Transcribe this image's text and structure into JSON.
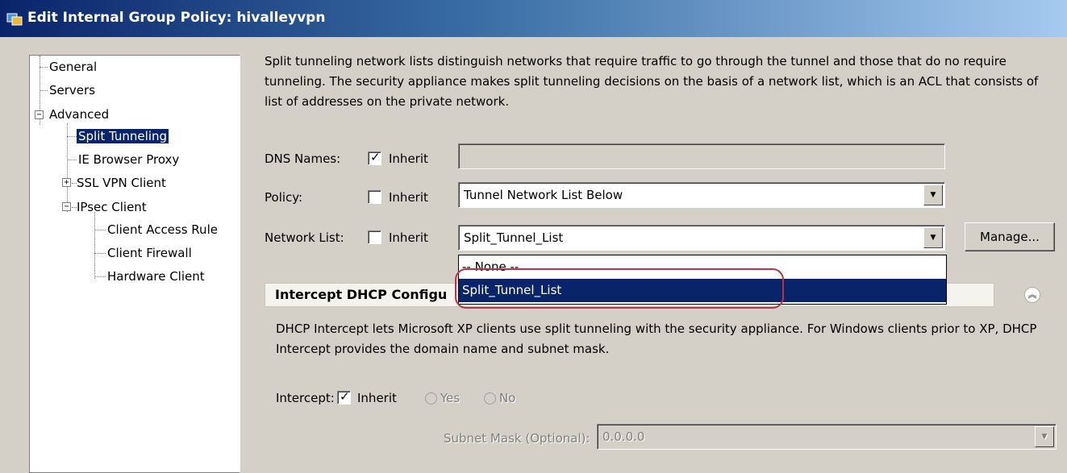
{
  "window": {
    "title": "Edit Internal Group Policy: hivalleyvpn"
  },
  "tree": {
    "items": [
      {
        "label": "General"
      },
      {
        "label": "Servers"
      },
      {
        "label": "Advanced"
      },
      {
        "label": "Split Tunneling"
      },
      {
        "label": "IE Browser Proxy"
      },
      {
        "label": "SSL VPN Client"
      },
      {
        "label": "IPsec Client"
      },
      {
        "label": "Client Access Rule"
      },
      {
        "label": "Client Firewall"
      },
      {
        "label": "Hardware Client"
      }
    ],
    "selected": "Split Tunneling"
  },
  "description": "Split tunneling network lists distinguish networks that require traffic to go through the tunnel and those that do no require tunneling. The security appliance makes split tunneling decisions on the basis of a network list, which is an ACL that consists of list of addresses on the private network.",
  "fields": {
    "dns_names": {
      "label": "DNS Names:",
      "inherit_label": "Inherit",
      "inherit_checked": true,
      "value": ""
    },
    "policy": {
      "label": "Policy:",
      "inherit_label": "Inherit",
      "inherit_checked": false,
      "value": "Tunnel Network List Below"
    },
    "network_list": {
      "label": "Network List:",
      "inherit_label": "Inherit",
      "inherit_checked": false,
      "value": "Split_Tunnel_List",
      "manage_label": "Manage..."
    }
  },
  "dropdown": {
    "options": [
      "-- None --",
      "Split_Tunnel_List"
    ],
    "selected": "Split_Tunnel_List"
  },
  "dhcp_section": {
    "title": "Intercept DHCP Configu",
    "description": "DHCP Intercept lets Microsoft XP clients use split tunneling with the security appliance. For Windows clients prior to XP, DHCP Intercept provides the domain name and subnet mask.",
    "intercept_label": "Intercept:",
    "inherit_label": "Inherit",
    "inherit_checked": true,
    "yes_label": "Yes",
    "no_label": "No",
    "subnet_label": "Subnet Mask (Optional):",
    "subnet_value": "0.0.0.0"
  },
  "colors": {
    "selection": "#0a246a",
    "highlight_oval": "#c0304a",
    "panel": "#d4d0c8"
  }
}
